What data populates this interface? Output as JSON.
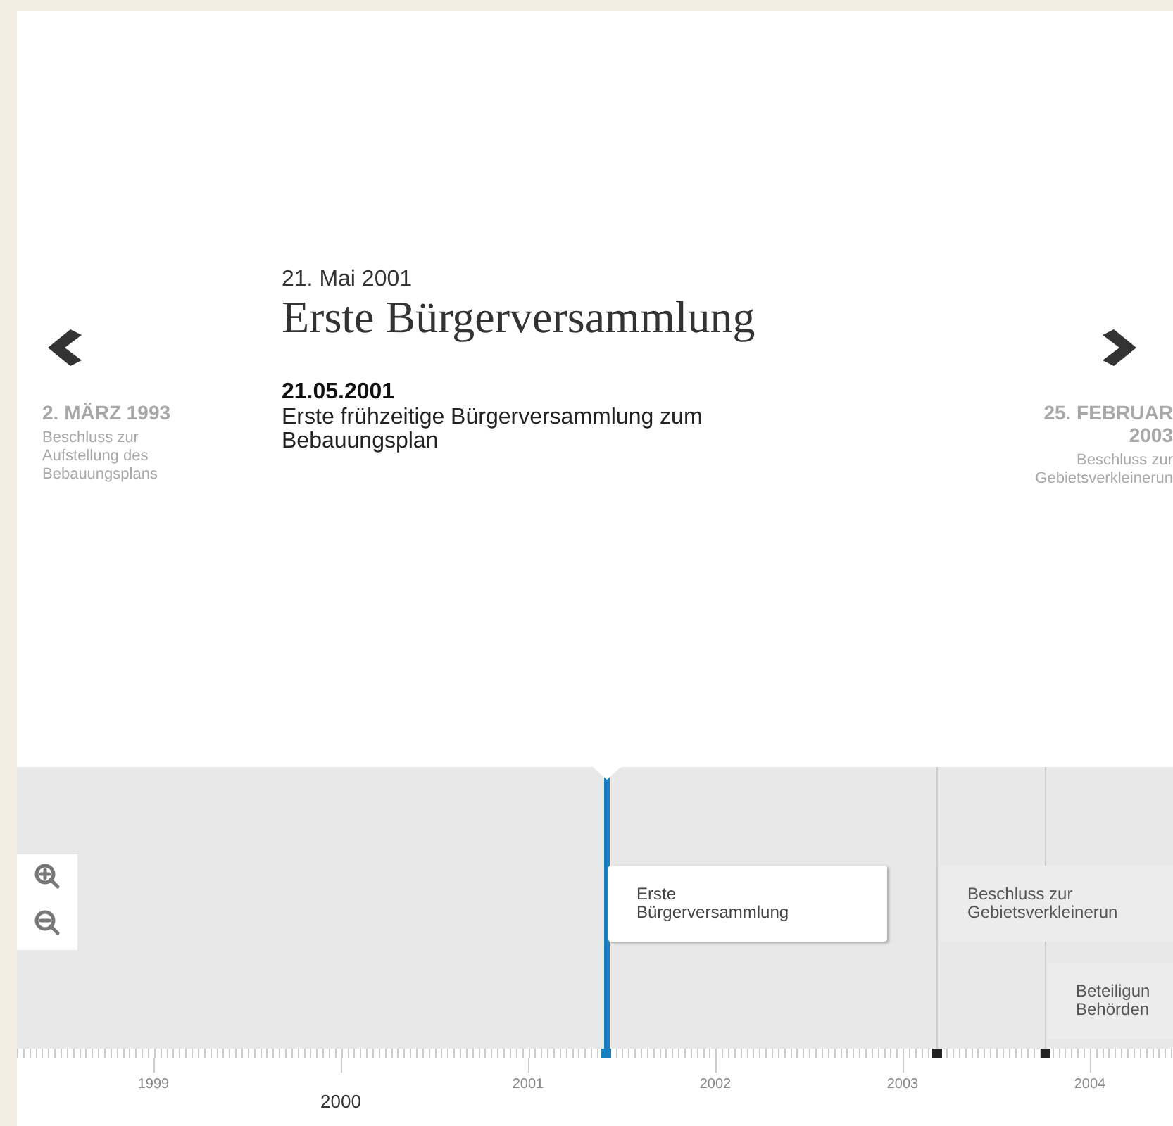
{
  "current": {
    "date": "21. Mai 2001",
    "title": "Erste Bürgerversammlung",
    "subdate": "21.05.2001",
    "text": "Erste frühzeitige Bürgerversammlung zum Bebauungsplan"
  },
  "previous": {
    "date": "2. MÄRZ 1993",
    "text": "Beschluss zur Aufstellung des Bebauungsplans"
  },
  "next": {
    "date": "25. FEBRUAR 2003",
    "text": "Beschluss zur Gebietsverkleinerun"
  },
  "events": [
    {
      "label": "Erste\nBürgerversammlung",
      "selected": true
    },
    {
      "label": "Beschluss zur\nGebietsverkleinerun",
      "selected": false
    },
    {
      "label": "Beteiligun\nBehörden",
      "selected": false
    }
  ],
  "years": [
    {
      "label": "1999",
      "major": false
    },
    {
      "label": "2000",
      "major": true
    },
    {
      "label": "2001",
      "major": false
    },
    {
      "label": "2002",
      "major": false
    },
    {
      "label": "2003",
      "major": false
    },
    {
      "label": "2004",
      "major": false
    }
  ]
}
